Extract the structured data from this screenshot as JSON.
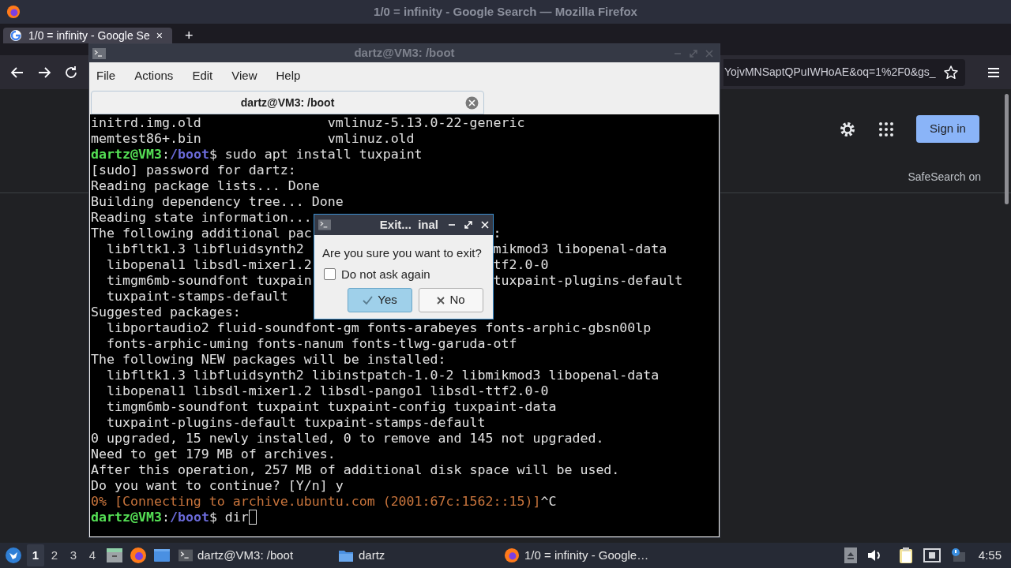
{
  "browser": {
    "title": "1/0 = infinity - Google Search — Mozilla Firefox",
    "tab": {
      "label": "1/0 = infinity - Google Se",
      "close": "×"
    },
    "new_tab": "+",
    "url": "YojvMNSaptQPuIWHoAE&oq=1%2F0&gs_",
    "sign_in": "Sign in",
    "safesearch": "SafeSearch on"
  },
  "terminal": {
    "title": "dartz@VM3: /boot",
    "menu": [
      "File",
      "Actions",
      "Edit",
      "View",
      "Help"
    ],
    "tab": {
      "label": "dartz@VM3: /boot",
      "selected": true
    },
    "lines": [
      {
        "kind": "columns",
        "cells": [
          "initrd.img.old",
          "vmlinuz-5.13.0-22-generic"
        ]
      },
      {
        "kind": "columns",
        "cells": [
          "memtest86+.bin",
          "vmlinuz.old"
        ]
      },
      {
        "kind": "prompt",
        "user": "dartz@VM3",
        "sep": ":",
        "path": "/boot",
        "command": "$ sudo apt install tuxpaint"
      },
      {
        "kind": "output",
        "text": "[sudo] password for dartz:"
      },
      {
        "kind": "output",
        "text": "Reading package lists... Done"
      },
      {
        "kind": "output",
        "text": "Building dependency tree... Done"
      },
      {
        "kind": "output",
        "text": "Reading state information..."
      },
      {
        "kind": "output",
        "text": "The following additional pac",
        "after": ":"
      },
      {
        "kind": "output",
        "text": "  libfltk1.3 libfluidsynth2",
        "after": "mikmod3 libopenal-data"
      },
      {
        "kind": "output",
        "text": "  libopenal1 libsdl-mixer1.2",
        "after": "tf2.0-0"
      },
      {
        "kind": "output",
        "text": "  timgm6mb-soundfont tuxpain",
        "after": "tuxpaint-plugins-default"
      },
      {
        "kind": "output",
        "text": "  tuxpaint-stamps-default"
      },
      {
        "kind": "output",
        "text": "Suggested packages:"
      },
      {
        "kind": "output",
        "text": "  libportaudio2 fluid-soundfont-gm fonts-arabeyes fonts-arphic-gbsn00lp"
      },
      {
        "kind": "output",
        "text": "  fonts-arphic-uming fonts-nanum fonts-tlwg-garuda-otf"
      },
      {
        "kind": "output",
        "text": "The following NEW packages will be installed:"
      },
      {
        "kind": "output",
        "text": "  libfltk1.3 libfluidsynth2 libinstpatch-1.0-2 libmikmod3 libopenal-data"
      },
      {
        "kind": "output",
        "text": "  libopenal1 libsdl-mixer1.2 libsdl-pango1 libsdl-ttf2.0-0"
      },
      {
        "kind": "output",
        "text": "  timgm6mb-soundfont tuxpaint tuxpaint-config tuxpaint-data"
      },
      {
        "kind": "output",
        "text": "  tuxpaint-plugins-default tuxpaint-stamps-default"
      },
      {
        "kind": "output",
        "text": "0 upgraded, 15 newly installed, 0 to remove and 145 not upgraded."
      },
      {
        "kind": "output",
        "text": "Need to get 179 MB of archives."
      },
      {
        "kind": "output",
        "text": "After this operation, 257 MB of additional disk space will be used."
      },
      {
        "kind": "output",
        "text": "Do you want to continue? [Y/n] y"
      },
      {
        "kind": "progress",
        "text": "0% [Connecting to archive.ubuntu.com (2001:67c:1562::15)]",
        "suffix": "^C"
      },
      {
        "kind": "prompt",
        "user": "dartz@VM3",
        "sep": ":",
        "path": "/boot",
        "command": "$ dir",
        "cursor": true
      }
    ]
  },
  "dialog": {
    "title": "Exit...  inal",
    "message": "Are you sure you want to exit?",
    "checkbox": {
      "label": "Do not ask again",
      "checked": false
    },
    "buttons": [
      {
        "label": "Yes",
        "kind": "yes",
        "selected": true
      },
      {
        "label": "No",
        "kind": "no",
        "selected": false
      }
    ]
  },
  "taskbar": {
    "workspaces": [
      {
        "label": "1",
        "selected": true
      },
      {
        "label": "2",
        "selected": false
      },
      {
        "label": "3",
        "selected": false
      },
      {
        "label": "4",
        "selected": false
      }
    ],
    "tasks": [
      {
        "label": "dartz@VM3: /boot",
        "kind": "terminal"
      },
      {
        "label": "dartz",
        "kind": "folder"
      },
      {
        "label": "1/0 = infinity - Google…",
        "kind": "browser"
      }
    ],
    "clock": "4:55"
  }
}
